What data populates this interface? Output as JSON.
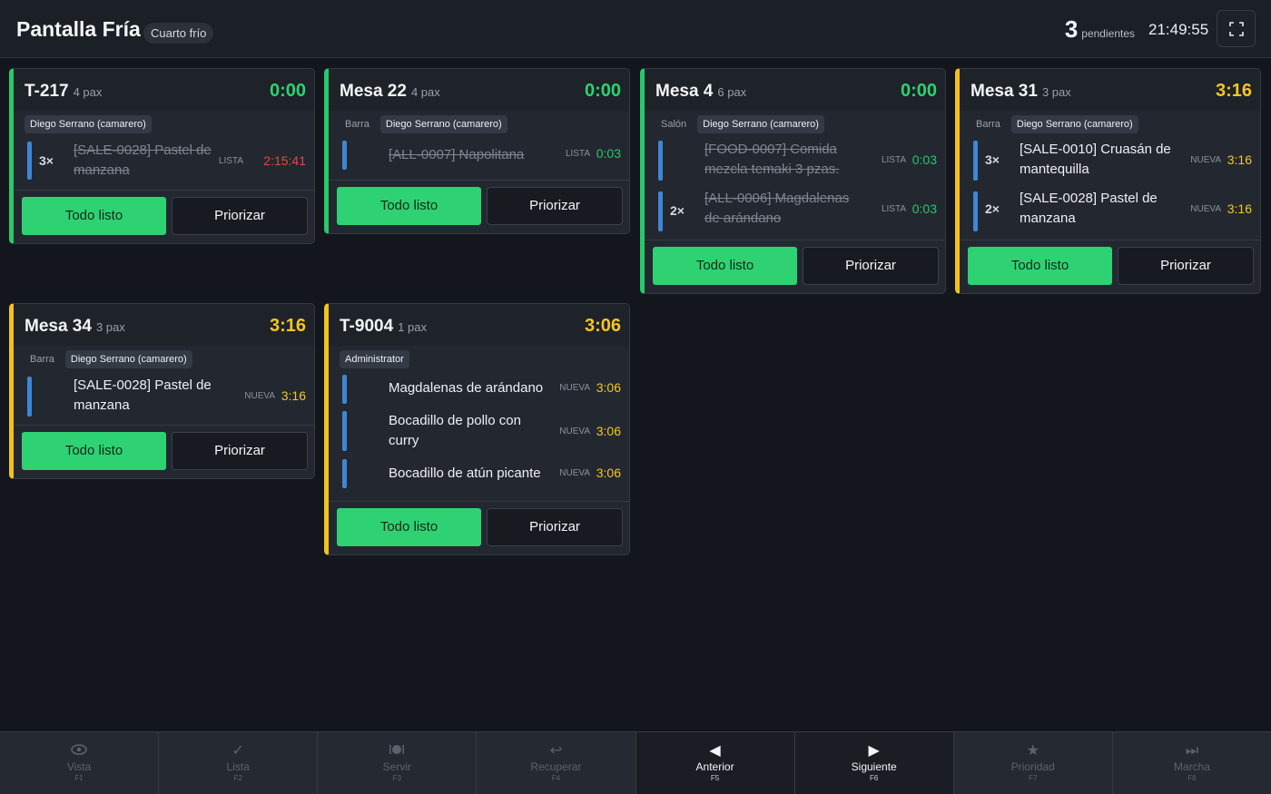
{
  "header": {
    "title": "Pantalla Fría",
    "station": "Cuarto frío",
    "pending_count": "3",
    "pending_label": "pendientes",
    "clock": "21:49:55"
  },
  "buttons": {
    "ready": "Todo listo",
    "prioritize": "Priorizar"
  },
  "colors": {
    "green": "#2ed273",
    "yellow": "#f1c21b",
    "blue": "#3d87d6",
    "red": "#e04848"
  },
  "cards": [
    {
      "title": "T-217",
      "pax": "4 pax",
      "timer": "0:00",
      "zone": "",
      "waiter": "Diego Serrano (camarero)",
      "items": [
        {
          "qty": "3×",
          "name": "[SALE-0028] Pastel de manzana",
          "state": "LISTA",
          "time": "2:15:41"
        }
      ]
    },
    {
      "title": "Mesa 22",
      "pax": "4 pax",
      "timer": "0:00",
      "zone": "Barra",
      "waiter": "Diego Serrano (camarero)",
      "items": [
        {
          "qty": "",
          "name": "[ALL-0007] Napolitana",
          "state": "LISTA",
          "time": "0:03"
        }
      ]
    },
    {
      "title": "Mesa 4",
      "pax": "6 pax",
      "timer": "0:00",
      "zone": "Salón",
      "waiter": "Diego Serrano (camarero)",
      "items": [
        {
          "qty": "",
          "name": "[FOOD-0007] Comida mezcla temaki 3 pzas.",
          "state": "LISTA",
          "time": "0:03"
        },
        {
          "qty": "2×",
          "name": "[ALL-0006] Magdalenas de arándano",
          "state": "LISTA",
          "time": "0:03"
        }
      ]
    },
    {
      "title": "Mesa 31",
      "pax": "3 pax",
      "timer": "3:16",
      "zone": "Barra",
      "waiter": "Diego Serrano (camarero)",
      "items": [
        {
          "qty": "3×",
          "name": "[SALE-0010] Cruasán de mantequilla",
          "state": "NUEVA",
          "time": "3:16"
        },
        {
          "qty": "2×",
          "name": "[SALE-0028] Pastel de manzana",
          "state": "NUEVA",
          "time": "3:16"
        }
      ]
    },
    {
      "title": "Mesa 34",
      "pax": "3 pax",
      "timer": "3:16",
      "zone": "Barra",
      "waiter": "Diego Serrano (camarero)",
      "items": [
        {
          "qty": "",
          "name": "[SALE-0028] Pastel de manzana",
          "state": "NUEVA",
          "time": "3:16"
        }
      ]
    },
    {
      "title": "T-9004",
      "pax": "1 pax",
      "timer": "3:06",
      "zone": "",
      "waiter": "Administrator",
      "items": [
        {
          "qty": "",
          "name": "Magdalenas de arándano",
          "state": "NUEVA",
          "time": "3:06"
        },
        {
          "qty": "",
          "name": "Bocadillo de pollo con curry",
          "state": "NUEVA",
          "time": "3:06"
        },
        {
          "qty": "",
          "name": "Bocadillo de atún picante",
          "state": "NUEVA",
          "time": "3:06"
        }
      ]
    }
  ],
  "footer": [
    {
      "label": "Vista",
      "key": "F1",
      "icon": "eye-icon"
    },
    {
      "label": "Lista",
      "key": "F2",
      "icon": "check-icon"
    },
    {
      "label": "Servir",
      "key": "F3",
      "icon": "plate-icon"
    },
    {
      "label": "Recuperar",
      "key": "F4",
      "icon": "undo-icon"
    },
    {
      "label": "Anterior",
      "key": "F5",
      "icon": "prev-icon"
    },
    {
      "label": "Siguiente",
      "key": "F6",
      "icon": "next-icon"
    },
    {
      "label": "Prioridad",
      "key": "F7",
      "icon": "star-icon"
    },
    {
      "label": "Marcha",
      "key": "F8",
      "icon": "skip-icon"
    }
  ]
}
